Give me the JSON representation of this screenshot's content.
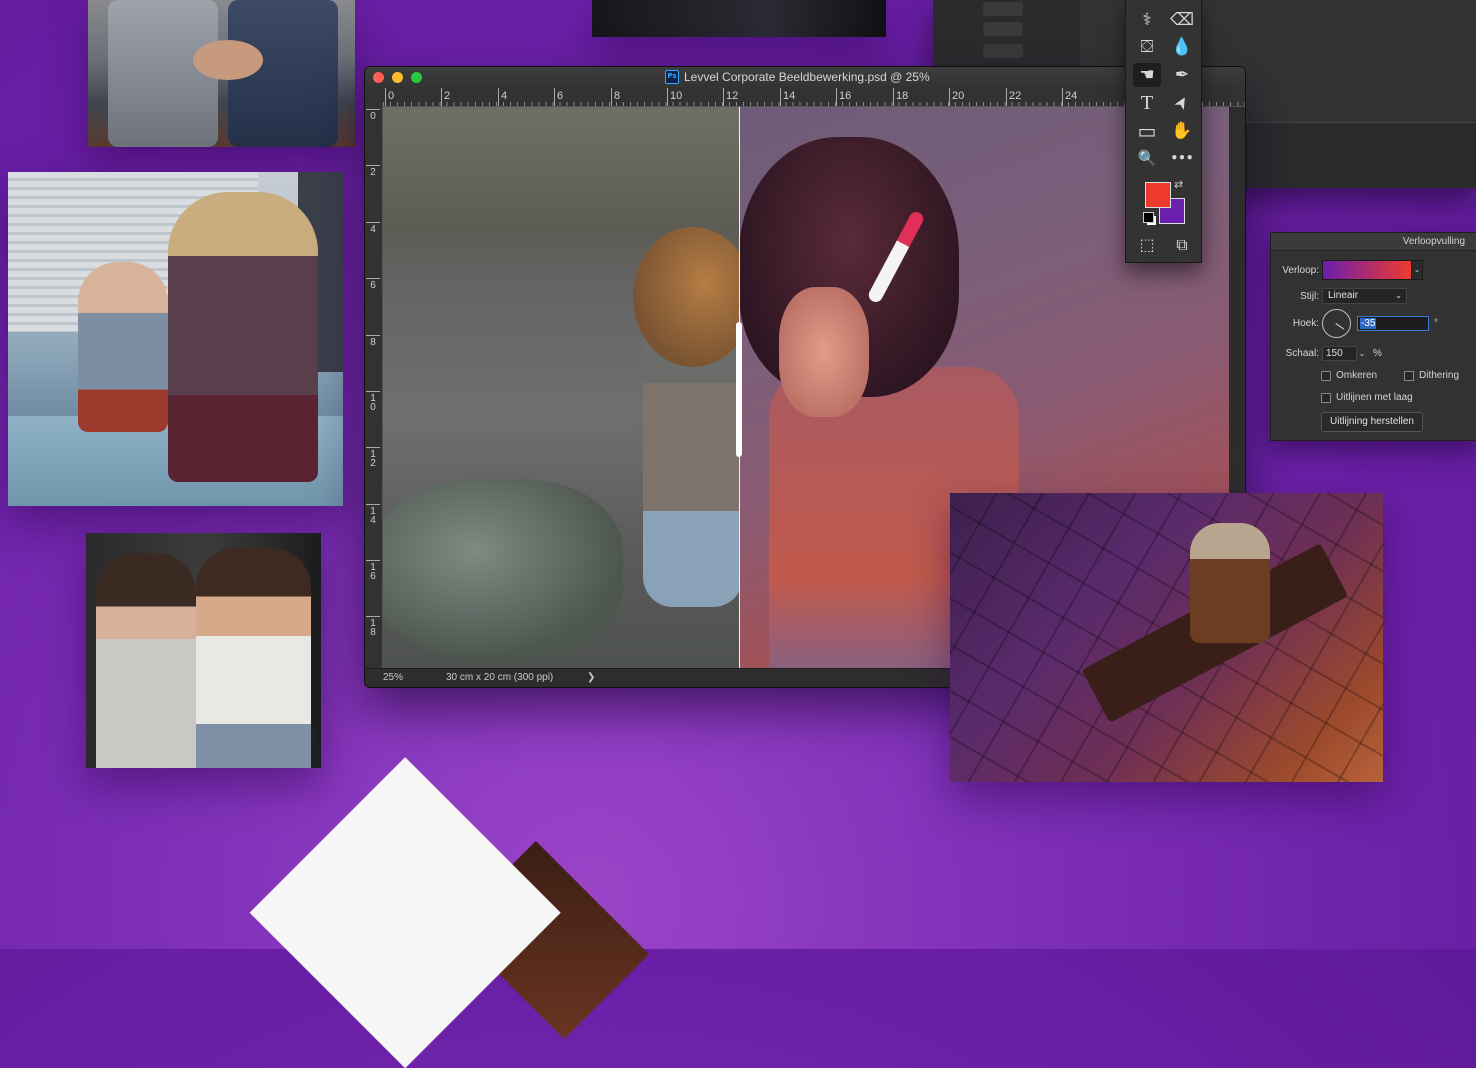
{
  "document": {
    "title": "Levvel Corporate Beeldbewerking.psd @ 25%",
    "app_badge": "Ps",
    "zoom": "25%",
    "doc_size": "30 cm x 20 cm (300 ppi)",
    "status_arrow": "❯"
  },
  "ruler": {
    "horizontal": [
      "0",
      "2",
      "4",
      "6",
      "8",
      "10",
      "12",
      "14",
      "16",
      "18",
      "20",
      "22",
      "24"
    ],
    "vertical": [
      "0",
      "2",
      "4",
      "6",
      "8",
      "1\n0",
      "1\n2",
      "1\n4",
      "1\n6",
      "1\n8"
    ]
  },
  "toolbar": {
    "tools": [
      {
        "name": "healing-brush-icon",
        "glyph": "⚕"
      },
      {
        "name": "eraser-icon",
        "glyph": "⌫"
      },
      {
        "name": "paint-bucket-icon",
        "glyph": "⛋"
      },
      {
        "name": "blur-drop-icon",
        "glyph": "💧"
      },
      {
        "name": "smudge-icon",
        "glyph": "☚"
      },
      {
        "name": "pen-icon",
        "glyph": "✒"
      },
      {
        "name": "type-icon",
        "glyph": "T"
      },
      {
        "name": "direct-selection-icon",
        "glyph": "➤"
      },
      {
        "name": "rectangle-icon",
        "glyph": "▭"
      },
      {
        "name": "hand-icon",
        "glyph": "✋"
      },
      {
        "name": "zoom-icon",
        "glyph": "🔍"
      },
      {
        "name": "more-tools-icon",
        "glyph": "•••"
      },
      {
        "name": "quick-mask-icon",
        "glyph": "⬚"
      },
      {
        "name": "screen-mode-icon",
        "glyph": "⧉"
      }
    ],
    "foreground_color": "#ee3a2e",
    "background_color": "#6a1fae",
    "swap_glyph": "⇄"
  },
  "gradient_panel": {
    "title": "Verloopvulling",
    "gradient_label": "Verloop:",
    "gradient_colors": [
      "#6a1fae",
      "#ee3a2e"
    ],
    "style_label": "Stijl:",
    "style_value": "Lineair",
    "angle_label": "Hoek:",
    "angle_value": "-35",
    "angle_unit": "°",
    "scale_label": "Schaal:",
    "scale_value": "150",
    "scale_unit": "%",
    "reverse_label": "Omkeren",
    "dither_label": "Dithering",
    "align_label": "Uitlijnen met laag",
    "reset_button": "Uitlijning herstellen"
  }
}
